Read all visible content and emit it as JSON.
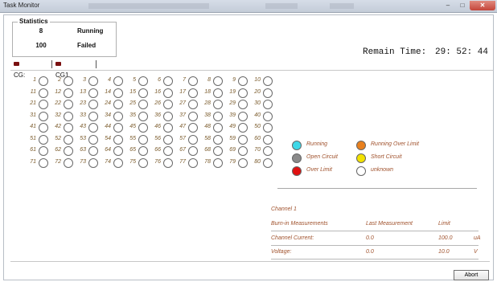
{
  "window": {
    "title": "Task Monitor",
    "buttons": {
      "minimize": "–",
      "maximize": "□",
      "close": "✕"
    }
  },
  "statistics": {
    "title": "Statistics",
    "running_count": "8",
    "running_label": "Running",
    "failed_count": "100",
    "failed_label": "Failed"
  },
  "remain": {
    "label": "Remain Time:",
    "value": "29: 52: 44"
  },
  "tabs": [
    {
      "label": "CG:"
    },
    {
      "label": "CG1"
    }
  ],
  "channels": [
    "1",
    "2",
    "3",
    "4",
    "5",
    "6",
    "7",
    "8",
    "9",
    "10",
    "11",
    "12",
    "13",
    "14",
    "15",
    "16",
    "17",
    "18",
    "19",
    "20",
    "21",
    "22",
    "23",
    "24",
    "25",
    "26",
    "27",
    "28",
    "29",
    "30",
    "31",
    "32",
    "33",
    "34",
    "35",
    "36",
    "37",
    "38",
    "39",
    "40",
    "41",
    "42",
    "43",
    "44",
    "45",
    "46",
    "47",
    "48",
    "49",
    "50",
    "51",
    "52",
    "53",
    "54",
    "55",
    "56",
    "57",
    "58",
    "59",
    "60",
    "61",
    "62",
    "63",
    "64",
    "65",
    "66",
    "67",
    "68",
    "69",
    "70",
    "71",
    "72",
    "73",
    "74",
    "75",
    "76",
    "77",
    "78",
    "79",
    "80"
  ],
  "legend": [
    {
      "label": "Running",
      "color": "#3fd8e8"
    },
    {
      "label": "Running Over Limit",
      "color": "#e8801e"
    },
    {
      "label": "Open Circuit",
      "color": "#8a8a8a"
    },
    {
      "label": "Short Circuit",
      "color": "#f2e200"
    },
    {
      "label": "Over Limit",
      "color": "#e01010"
    },
    {
      "label": "unknown",
      "color": "#ffffff"
    }
  ],
  "channel_info": {
    "channel": "Channel 1",
    "headers": {
      "name": "Burn-in Measurements",
      "last": "Last Measurement",
      "limit": "Limit"
    },
    "rows": [
      {
        "name": "Channel Current:",
        "last": "0.0",
        "limit": "100.0",
        "unit": "uA"
      },
      {
        "name": "Voltage:",
        "last": "0.0",
        "limit": "10.0",
        "unit": "V"
      }
    ]
  },
  "abort_label": "Abort"
}
